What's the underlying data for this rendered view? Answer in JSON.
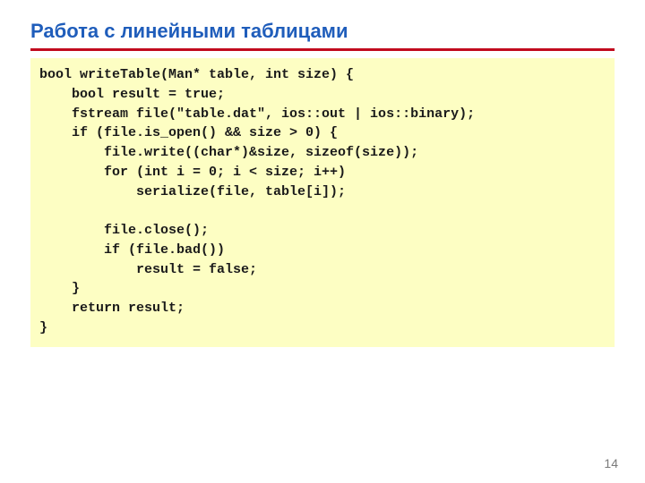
{
  "title": "Работа с линейными таблицами",
  "code": "bool writeTable(Man* table, int size) {\n    bool result = true;\n    fstream file(\"table.dat\", ios::out | ios::binary);\n    if (file.is_open() && size > 0) {\n        file.write((char*)&size, sizeof(size));\n        for (int i = 0; i < size; i++)\n            serialize(file, table[i]);\n\n        file.close();\n        if (file.bad())\n            result = false;\n    }\n    return result;\n}",
  "page_number": "14"
}
